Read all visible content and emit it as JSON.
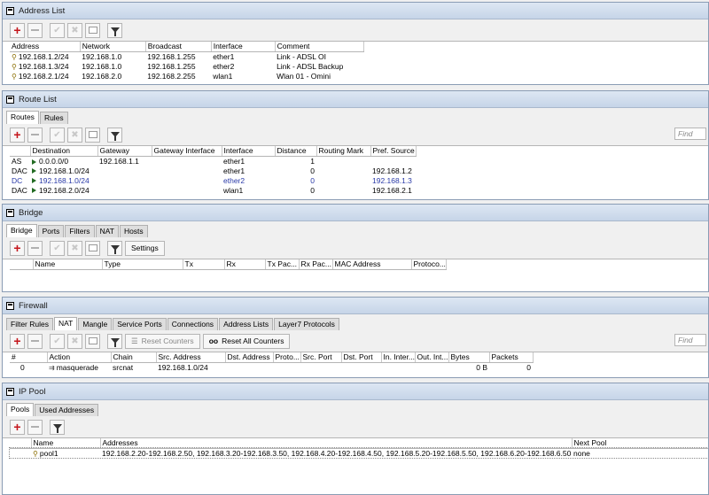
{
  "address_list": {
    "title": "Address List",
    "columns": [
      "Address",
      "Network",
      "Broadcast",
      "Interface",
      "Comment"
    ],
    "rows": [
      [
        "192.168.1.2/24",
        "192.168.1.0",
        "192.168.1.255",
        "ether1",
        "Link - ADSL OI"
      ],
      [
        "192.168.1.3/24",
        "192.168.1.0",
        "192.168.1.255",
        "ether2",
        "Link - ADSL Backup"
      ],
      [
        "192.168.2.1/24",
        "192.168.2.0",
        "192.168.2.255",
        "wlan1",
        "Wlan 01 - Omini"
      ]
    ]
  },
  "route_list": {
    "title": "Route List",
    "tabs": [
      "Routes",
      "Rules"
    ],
    "find_placeholder": "Find",
    "columns": [
      "",
      "Destination",
      "Gateway",
      "Gateway Interface",
      "Interface",
      "Distance",
      "Routing Mark",
      "Pref. Source"
    ],
    "rows": [
      [
        "AS",
        "0.0.0.0/0",
        "192.168.1.1",
        "",
        "ether1",
        "1",
        "",
        ""
      ],
      [
        "DAC",
        "192.168.1.0/24",
        "",
        "",
        "ether1",
        "0",
        "",
        "192.168.1.2"
      ],
      [
        "DC",
        "192.168.1.0/24",
        "",
        "",
        "ether2",
        "0",
        "",
        "192.168.1.3"
      ],
      [
        "DAC",
        "192.168.2.0/24",
        "",
        "",
        "wlan1",
        "0",
        "",
        "192.168.2.1"
      ]
    ]
  },
  "bridge": {
    "title": "Bridge",
    "tabs": [
      "Bridge",
      "Ports",
      "Filters",
      "NAT",
      "Hosts"
    ],
    "settings_label": "Settings",
    "columns": [
      "",
      "Name",
      "Type",
      "Tx",
      "Rx",
      "Tx Pac...",
      "Rx Pac...",
      "MAC Address",
      "Protoco..."
    ]
  },
  "firewall": {
    "title": "Firewall",
    "tabs": [
      "Filter Rules",
      "NAT",
      "Mangle",
      "Service Ports",
      "Connections",
      "Address Lists",
      "Layer7 Protocols"
    ],
    "reset_counters_label": "Reset Counters",
    "reset_all_counters_label": "Reset All Counters",
    "find_placeholder": "Find",
    "columns": [
      "#",
      "Action",
      "Chain",
      "Src. Address",
      "Dst. Address",
      "Proto...",
      "Src. Port",
      "Dst. Port",
      "In. Inter...",
      "Out. Int...",
      "Bytes",
      "Packets"
    ],
    "rows": [
      [
        "0",
        "masquerade",
        "srcnat",
        "192.168.1.0/24",
        "",
        "",
        "",
        "",
        "",
        "",
        "0 B",
        "0"
      ]
    ]
  },
  "ip_pool": {
    "title": "IP Pool",
    "tabs": [
      "Pools",
      "Used Addresses"
    ],
    "columns": [
      "",
      "Name",
      "Addresses",
      "Next Pool"
    ],
    "rows": [
      [
        "",
        "pool1",
        "192.168.2.20-192.168.2.50, 192.168.3.20-192.168.3.50, 192.168.4.20-192.168.4.50, 192.168.5.20-192.168.5.50, 192.168.6.20-192.168.6.50",
        "none"
      ]
    ]
  }
}
